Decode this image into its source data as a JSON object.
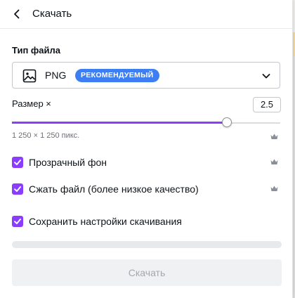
{
  "header": {
    "title": "Скачать"
  },
  "file_type": {
    "label": "Тип файла",
    "selected": "PNG",
    "badge": "РЕКОМЕНДУЕМЫЙ"
  },
  "size": {
    "label": "Размер ×",
    "value": "2.5",
    "slider_fraction": 0.8,
    "dimensions": "1 250 × 1 250 пикс."
  },
  "options": [
    {
      "label": "Прозрачный фон",
      "checked": true,
      "premium": true
    },
    {
      "label": "Сжать файл (более низкое качество)",
      "checked": true,
      "premium": true
    },
    {
      "label": "Сохранить настройки скачивания",
      "checked": true,
      "premium": false
    }
  ],
  "download_button": {
    "label": "Скачать"
  },
  "colors": {
    "accent": "#8b3dff",
    "badge": "#3d7ef3",
    "button_disabled_bg": "#f0f1f3",
    "button_disabled_text": "#a4a8ae"
  },
  "icons": {
    "back": "chevron-left-icon",
    "file_type": "image-icon",
    "dropdown": "chevron-down-icon",
    "premium": "crown-icon",
    "checkbox": "checkmark-icon"
  }
}
